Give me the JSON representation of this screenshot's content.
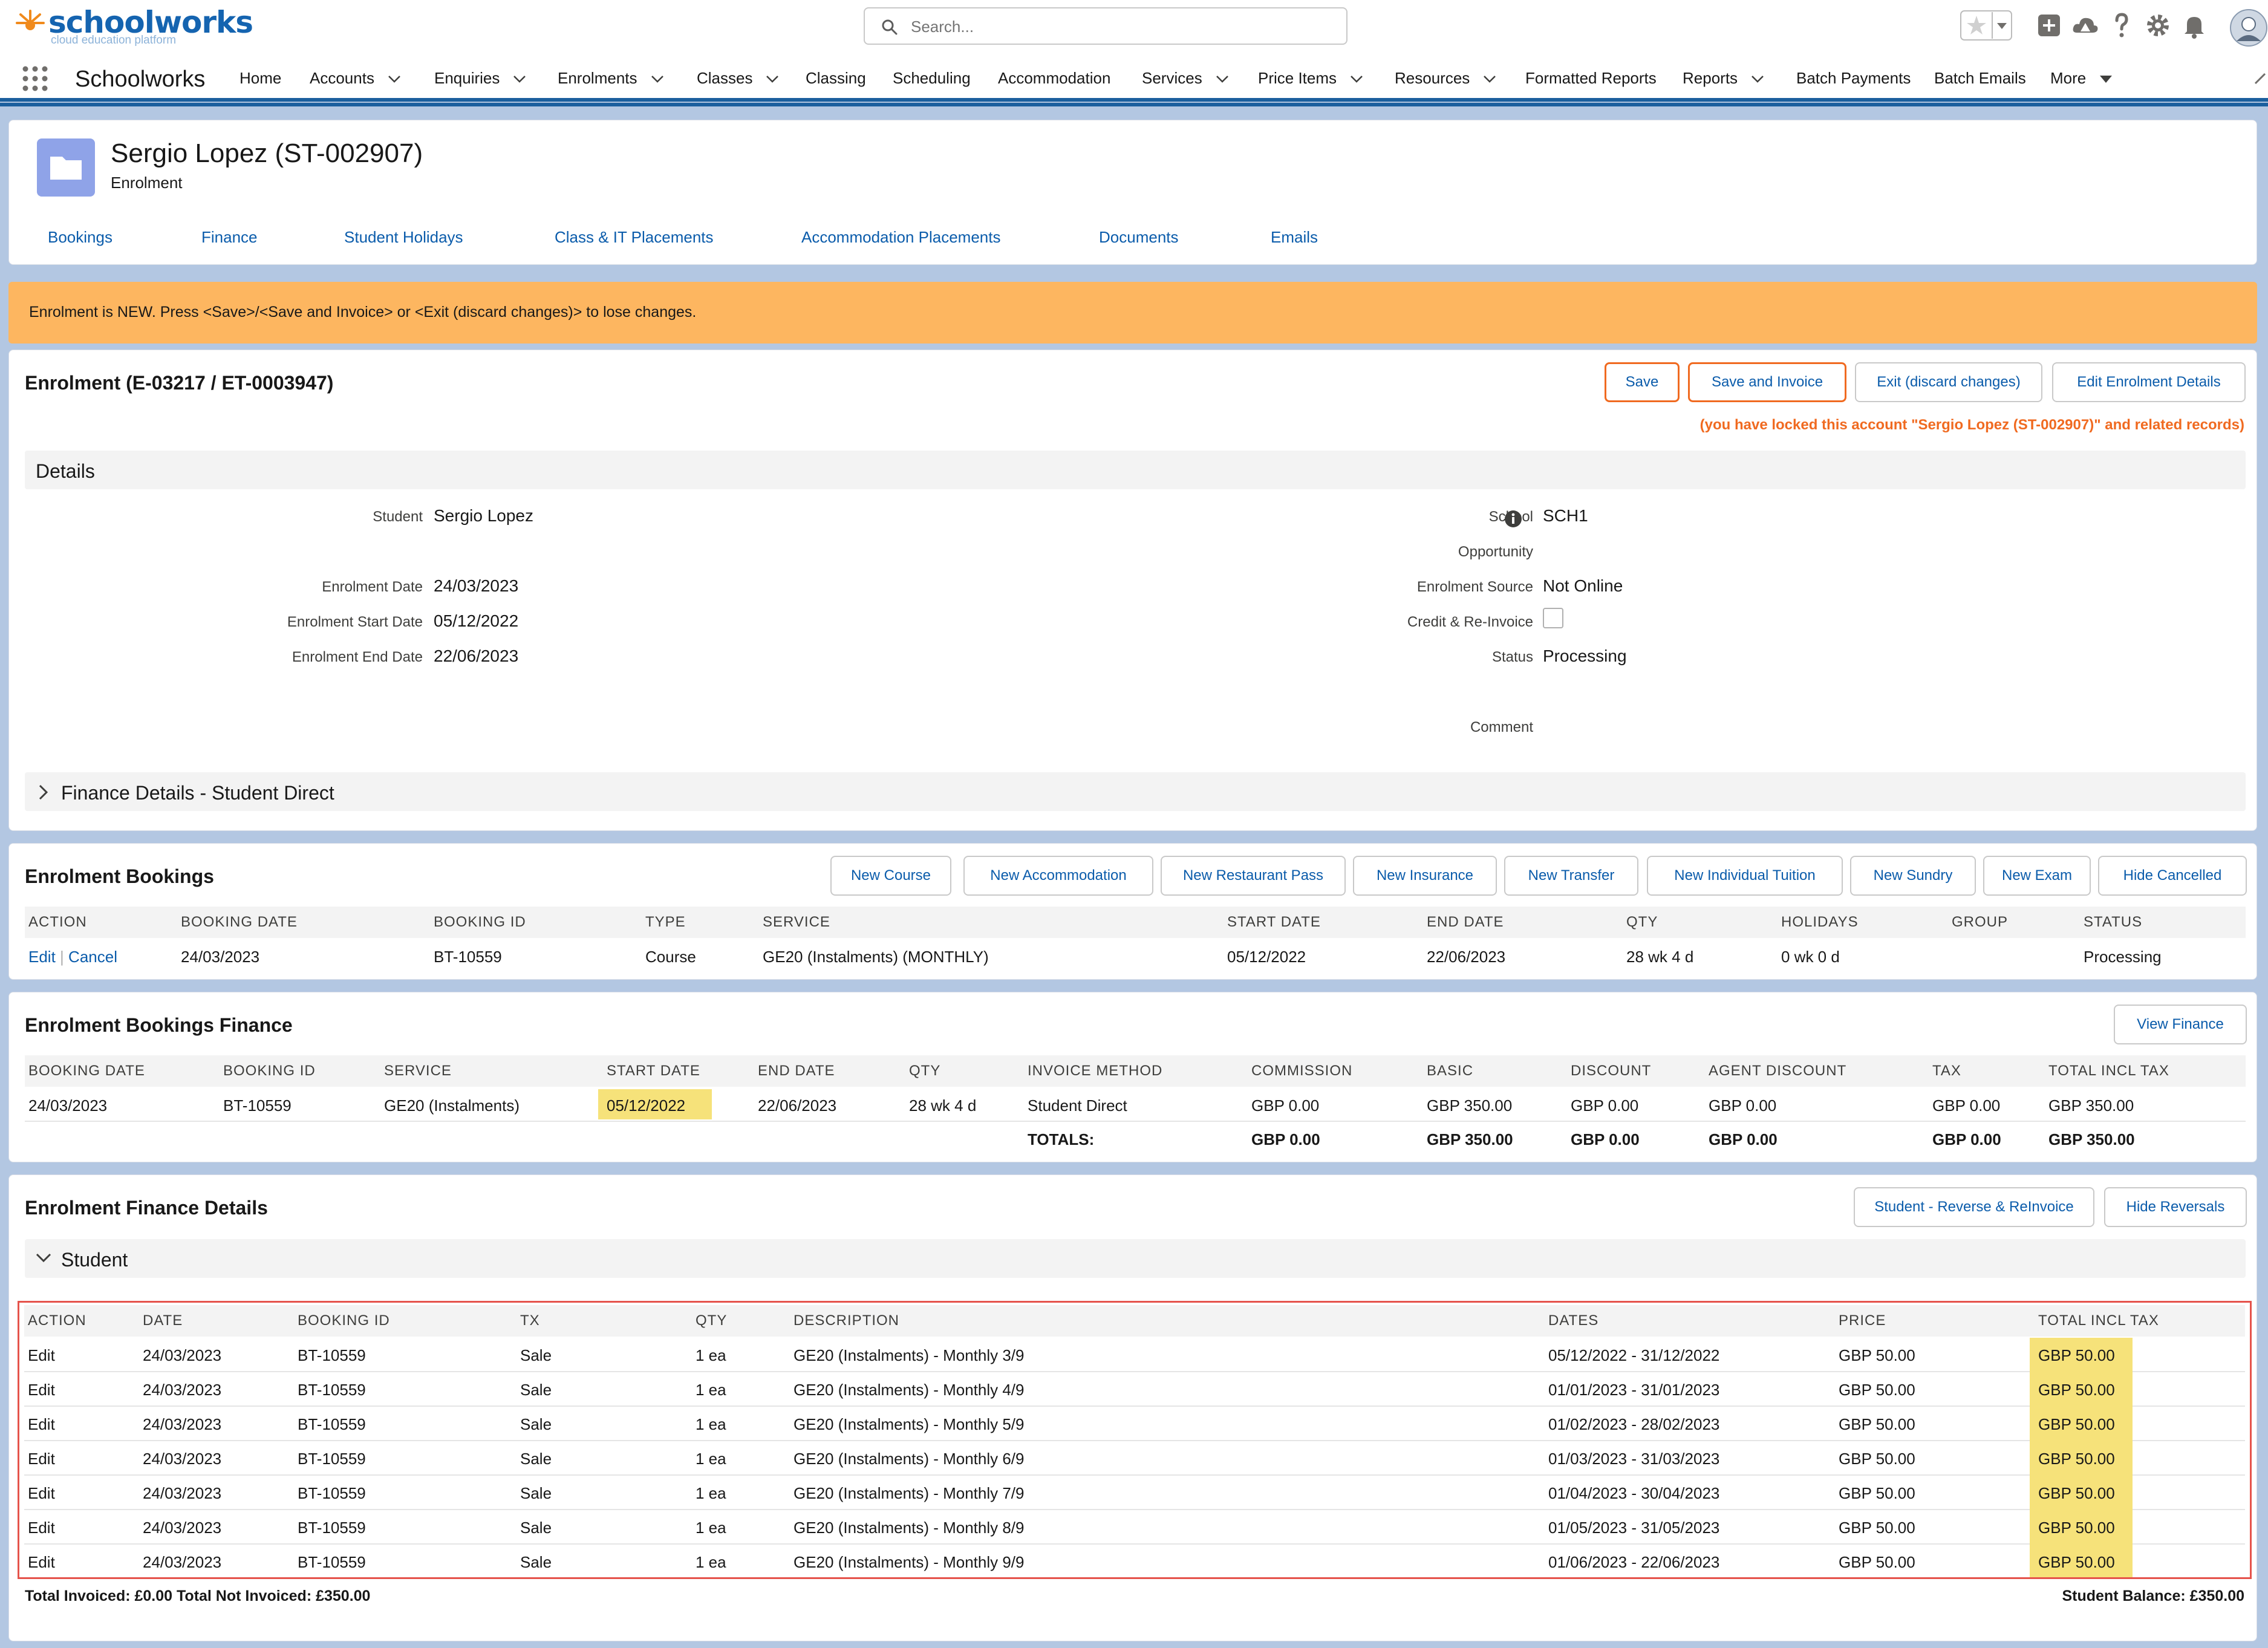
{
  "header": {
    "logo_text_a": "school",
    "logo_text_b": "works",
    "logo_sub": "cloud education platform",
    "search_placeholder": "Search..."
  },
  "nav": {
    "app_name": "Schoolworks",
    "items": [
      {
        "label": "Home"
      },
      {
        "label": "Accounts"
      },
      {
        "label": "Enquiries"
      },
      {
        "label": "Enrolments"
      },
      {
        "label": "Classes"
      },
      {
        "label": "Classing"
      },
      {
        "label": "Scheduling"
      },
      {
        "label": "Accommodation"
      },
      {
        "label": "Services"
      },
      {
        "label": "Price Items"
      },
      {
        "label": "Resources"
      },
      {
        "label": "Formatted Reports"
      },
      {
        "label": "Reports"
      },
      {
        "label": "Batch Payments"
      },
      {
        "label": "Batch Emails"
      },
      {
        "label": "More"
      }
    ]
  },
  "record": {
    "title": "Sergio Lopez (ST-002907)",
    "subtitle": "Enrolment",
    "tabs": [
      "Bookings",
      "Finance",
      "Student Holidays",
      "Class & IT Placements",
      "Accommodation Placements",
      "Documents",
      "Emails"
    ]
  },
  "alert": {
    "text": "Enrolment is NEW. Press <Save>/<Save and Invoice> or <Exit (discard changes)> to lose changes."
  },
  "enrolment": {
    "title": "Enrolment (E-03217 / ET-0003947)",
    "buttons": {
      "save": "Save",
      "save_invoice": "Save and Invoice",
      "exit": "Exit (discard changes)",
      "edit_details": "Edit Enrolment Details"
    },
    "lock_notice": "(you have locked this account \"Sergio Lopez (ST-002907)\" and related records)",
    "details_label": "Details",
    "fields": {
      "student_label": "Student",
      "student_value": "Sergio Lopez",
      "enrolment_date_label": "Enrolment Date",
      "enrolment_date_value": "24/03/2023",
      "start_date_label": "Enrolment Start Date",
      "start_date_value": "05/12/2022",
      "end_date_label": "Enrolment End Date",
      "end_date_value": "22/06/2023",
      "school_label": "School",
      "school_value": "SCH1",
      "opportunity_label": "Opportunity",
      "source_label": "Enrolment Source",
      "source_value": "Not Online",
      "credit_label": "Credit & Re-Invoice",
      "status_label": "Status",
      "status_value": "Processing",
      "comment_label": "Comment"
    },
    "finance_details_label": "Finance Details - Student Direct"
  },
  "bookings": {
    "title": "Enrolment Bookings",
    "buttons": [
      "New Course",
      "New Accommodation",
      "New Restaurant Pass",
      "New Insurance",
      "New Transfer",
      "New Individual Tuition",
      "New Sundry",
      "New Exam",
      "Hide Cancelled"
    ],
    "headers": [
      "ACTION",
      "BOOKING DATE",
      "BOOKING ID",
      "TYPE",
      "SERVICE",
      "START DATE",
      "END DATE",
      "QTY",
      "HOLIDAYS",
      "GROUP",
      "STATUS"
    ],
    "row": {
      "action_edit": "Edit",
      "action_sep": "|",
      "action_cancel": "Cancel",
      "booking_date": "24/03/2023",
      "booking_id": "BT-10559",
      "type": "Course",
      "service": "GE20 (Instalments) (MONTHLY)",
      "start_date": "05/12/2022",
      "end_date": "22/06/2023",
      "qty": "28 wk 4 d",
      "holidays": "0 wk 0 d",
      "group": "",
      "status": "Processing"
    }
  },
  "bookings_finance": {
    "title": "Enrolment Bookings Finance",
    "view_button": "View Finance",
    "headers": [
      "BOOKING DATE",
      "BOOKING ID",
      "SERVICE",
      "START DATE",
      "END DATE",
      "QTY",
      "INVOICE METHOD",
      "COMMISSION",
      "BASIC",
      "DISCOUNT",
      "AGENT DISCOUNT",
      "TAX",
      "TOTAL INCL TAX"
    ],
    "row": {
      "booking_date": "24/03/2023",
      "booking_id": "BT-10559",
      "service": "GE20 (Instalments)",
      "start_date": "05/12/2022",
      "end_date": "22/06/2023",
      "qty": "28 wk 4 d",
      "invoice_method": "Student Direct",
      "commission": "GBP 0.00",
      "basic": "GBP 350.00",
      "discount": "GBP 0.00",
      "agent_discount": "GBP 0.00",
      "tax": "GBP 0.00",
      "total": "GBP 350.00"
    },
    "totals": {
      "label": "TOTALS:",
      "commission": "GBP 0.00",
      "basic": "GBP 350.00",
      "discount": "GBP 0.00",
      "agent_discount": "GBP 0.00",
      "tax": "GBP 0.00",
      "total": "GBP 350.00"
    }
  },
  "finance_details": {
    "title": "Enrolment Finance Details",
    "buttons": [
      "Student - Reverse & ReInvoice",
      "Hide Reversals"
    ],
    "student_section": "Student",
    "headers": [
      "ACTION",
      "DATE",
      "BOOKING ID",
      "TX",
      "QTY",
      "DESCRIPTION",
      "DATES",
      "PRICE",
      "TOTAL INCL TAX"
    ],
    "rows": [
      {
        "action": "Edit",
        "date": "24/03/2023",
        "booking_id": "BT-10559",
        "tx": "Sale",
        "qty": "1 ea",
        "description": "GE20 (Instalments) - Monthly 3/9",
        "dates": "05/12/2022 - 31/12/2022",
        "price": "GBP 50.00",
        "total": "GBP 50.00"
      },
      {
        "action": "Edit",
        "date": "24/03/2023",
        "booking_id": "BT-10559",
        "tx": "Sale",
        "qty": "1 ea",
        "description": "GE20 (Instalments) - Monthly 4/9",
        "dates": "01/01/2023 - 31/01/2023",
        "price": "GBP 50.00",
        "total": "GBP 50.00"
      },
      {
        "action": "Edit",
        "date": "24/03/2023",
        "booking_id": "BT-10559",
        "tx": "Sale",
        "qty": "1 ea",
        "description": "GE20 (Instalments) - Monthly 5/9",
        "dates": "01/02/2023 - 28/02/2023",
        "price": "GBP 50.00",
        "total": "GBP 50.00"
      },
      {
        "action": "Edit",
        "date": "24/03/2023",
        "booking_id": "BT-10559",
        "tx": "Sale",
        "qty": "1 ea",
        "description": "GE20 (Instalments) - Monthly 6/9",
        "dates": "01/03/2023 - 31/03/2023",
        "price": "GBP 50.00",
        "total": "GBP 50.00"
      },
      {
        "action": "Edit",
        "date": "24/03/2023",
        "booking_id": "BT-10559",
        "tx": "Sale",
        "qty": "1 ea",
        "description": "GE20 (Instalments) - Monthly 7/9",
        "dates": "01/04/2023 - 30/04/2023",
        "price": "GBP 50.00",
        "total": "GBP 50.00"
      },
      {
        "action": "Edit",
        "date": "24/03/2023",
        "booking_id": "BT-10559",
        "tx": "Sale",
        "qty": "1 ea",
        "description": "GE20 (Instalments) - Monthly 8/9",
        "dates": "01/05/2023 - 31/05/2023",
        "price": "GBP 50.00",
        "total": "GBP 50.00"
      },
      {
        "action": "Edit",
        "date": "24/03/2023",
        "booking_id": "BT-10559",
        "tx": "Sale",
        "qty": "1 ea",
        "description": "GE20 (Instalments) - Monthly 9/9",
        "dates": "01/06/2023 - 22/06/2023",
        "price": "GBP 50.00",
        "total": "GBP 50.00"
      }
    ],
    "footer_left": "Total Invoiced: £0.00 Total Not Invoiced: £350.00",
    "footer_right": "Student Balance: £350.00"
  },
  "colors": {
    "brand_blue": "#1564b0",
    "link_blue": "#0b5cab",
    "alert_orange": "#fdb660",
    "button_orange": "#f06a20",
    "lock_text": "#f06a20",
    "highlight_yellow": "#f6e27a",
    "selection_red": "#e5534b"
  },
  "icons": {
    "logo": "sunburst-logo-icon",
    "search": "search-icon",
    "favorites": "star-icon",
    "add": "plus-icon",
    "trailhead": "cloud-icon",
    "help": "question-icon",
    "settings": "gear-icon",
    "notifications": "bell-icon",
    "avatar": "avatar-icon",
    "record": "folder-icon",
    "info": "info-icon"
  }
}
